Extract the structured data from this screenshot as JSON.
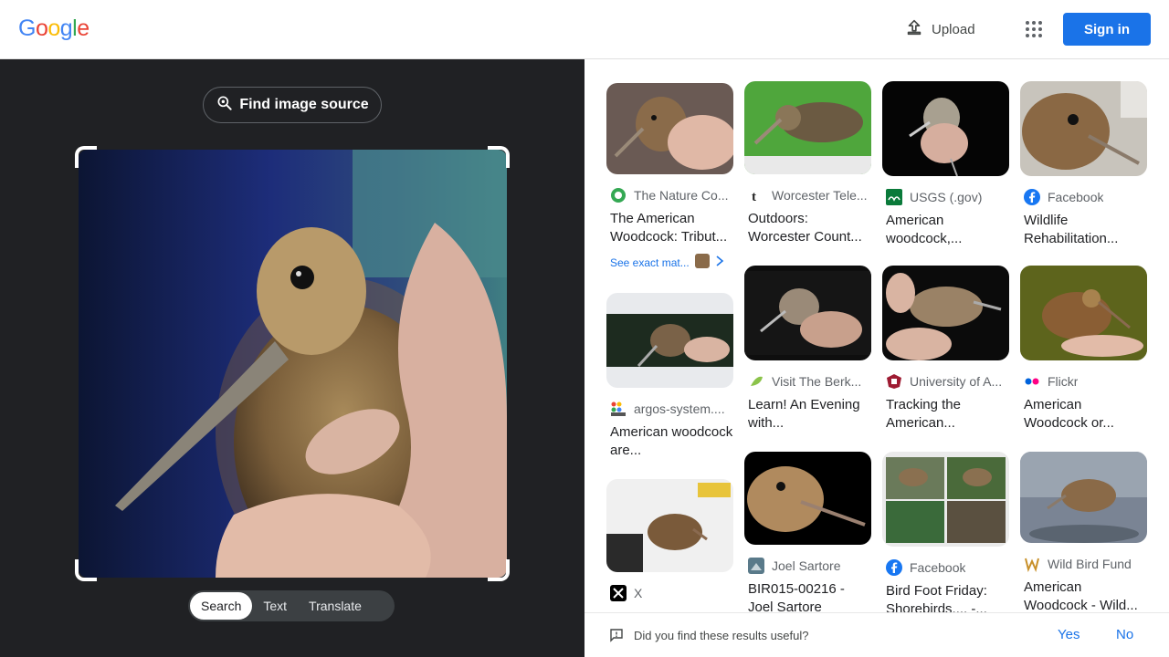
{
  "header": {
    "logo_letters": [
      "G",
      "o",
      "o",
      "g",
      "l",
      "e"
    ],
    "logo_colors": [
      "#4285F4",
      "#EA4335",
      "#FBBC05",
      "#4285F4",
      "#34A853",
      "#EA4335"
    ],
    "upload_label": "Upload",
    "signin_label": "Sign in",
    "accent": "#1a73e8"
  },
  "lens": {
    "find_source_label": "Find image source",
    "modes": [
      "Search",
      "Text",
      "Translate"
    ],
    "active_mode": "Search"
  },
  "results": [
    {
      "source": "The Nature Co...",
      "title": "The American Woodcock: Tribut...",
      "icon": "globe-icon",
      "exact_label": "See exact mat..."
    },
    {
      "source": "Worcester Tele...",
      "title": "Outdoors: Worcester Count...",
      "icon": "t-icon"
    },
    {
      "source": "USGS (.gov)",
      "title": "American woodcock,...",
      "icon": "usgs-icon"
    },
    {
      "source": "Facebook",
      "title": "Wildlife Rehabilitation...",
      "icon": "facebook-icon"
    },
    {
      "source": "argos-system....",
      "title": "American woodcock are...",
      "icon": "cls-icon"
    },
    {
      "source": "Visit The Berk...",
      "title": "Learn! An Evening with...",
      "icon": "leaf-icon"
    },
    {
      "source": "University of A...",
      "title": "Tracking the American...",
      "icon": "university-icon"
    },
    {
      "source": "Flickr",
      "title": "American Woodcock or...",
      "icon": "flickr-icon"
    },
    {
      "source": "X",
      "title": "",
      "icon": "x-icon"
    },
    {
      "source": "Joel Sartore",
      "title": "BIR015-00216 - Joel Sartore",
      "icon": "joel-sartore-icon"
    },
    {
      "source": "Facebook",
      "title": "Bird Foot Friday: Shorebirds,... -...",
      "icon": "facebook-icon"
    },
    {
      "source": "Wild Bird Fund",
      "title": "American Woodcock - Wild...",
      "icon": "wild-bird-fund-icon"
    }
  ],
  "feedback": {
    "question": "Did you find these results useful?",
    "yes": "Yes",
    "no": "No"
  }
}
